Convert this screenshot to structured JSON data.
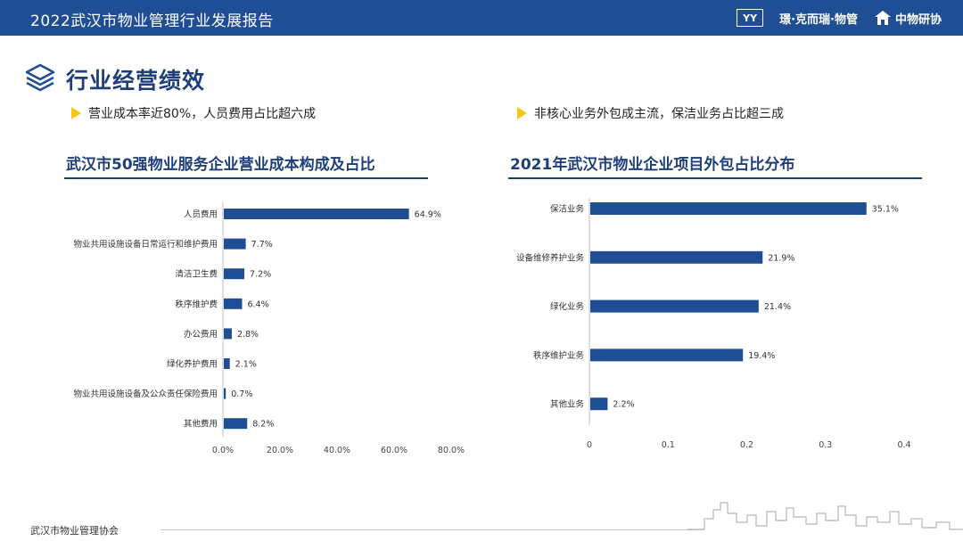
{
  "header": {
    "title": "2022武汉市物业管理行业发展报告",
    "logos": [
      "YY",
      "璟·克而瑞·物管",
      "中物研协"
    ]
  },
  "section": {
    "title": "行业经营绩效"
  },
  "bullets": [
    "营业成本率近80%，人员费用占比超六成",
    "非核心业务外包成主流，保洁业务占比超三成"
  ],
  "footer": {
    "text": "武汉市物业管理协会"
  },
  "colors": {
    "bar": "#1f4e95",
    "header": "#1f4e95",
    "title": "#1f3f7a",
    "bullet": "#f5c518"
  },
  "chart_data": [
    {
      "type": "bar",
      "orientation": "horizontal",
      "title": "武汉市50强物业服务企业营业成本构成及占比",
      "categories": [
        "人员费用",
        "物业共用设施设备日常运行和维护费用",
        "清洁卫生费",
        "秩序维护费",
        "办公费用",
        "绿化养护费用",
        "物业共用设施设备及公众责任保险费用",
        "其他费用"
      ],
      "values": [
        64.9,
        7.7,
        7.2,
        6.4,
        2.8,
        2.1,
        0.7,
        8.2
      ],
      "data_labels": [
        "64.9%",
        "7.7%",
        "7.2%",
        "6.4%",
        "2.8%",
        "2.1%",
        "0.7%",
        "8.2%"
      ],
      "xlim": [
        0,
        80
      ],
      "xticks": [
        "0.0%",
        "20.0%",
        "40.0%",
        "60.0%",
        "80.0%"
      ],
      "grid": false
    },
    {
      "type": "bar",
      "orientation": "horizontal",
      "title": "2021年武汉市物业企业项目外包占比分布",
      "categories": [
        "保洁业务",
        "设备维修养护业务",
        "绿化业务",
        "秩序维护业务",
        "其他业务"
      ],
      "values": [
        0.351,
        0.219,
        0.214,
        0.194,
        0.022
      ],
      "data_labels": [
        "35.1%",
        "21.9%",
        "21.4%",
        "19.4%",
        "2.2%"
      ],
      "xlim": [
        0,
        0.4
      ],
      "xticks": [
        "0",
        "0.1",
        "0.2",
        "0.3",
        "0.4"
      ],
      "grid": false
    }
  ]
}
